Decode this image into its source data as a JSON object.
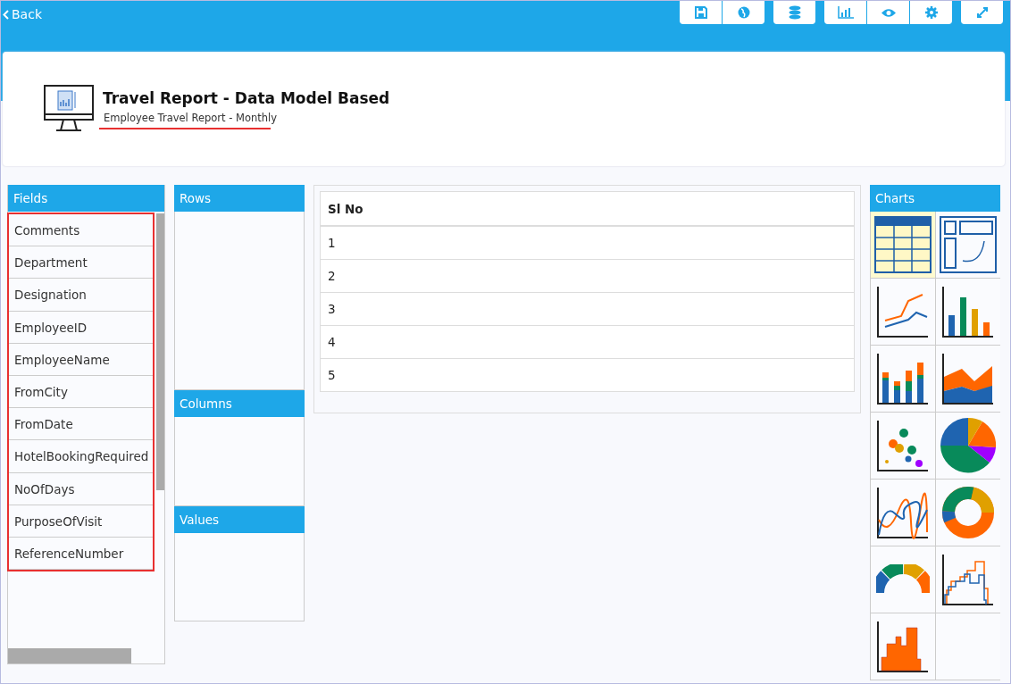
{
  "topbar": {
    "back_label": "Back"
  },
  "header": {
    "title": "Travel Report - Data Model Based",
    "subtitle": "Employee Travel Report - Monthly"
  },
  "fields": {
    "title": "Fields",
    "items": [
      "Comments",
      "Department",
      "Designation",
      "EmployeeID",
      "EmployeeName",
      "FromCity",
      "FromDate",
      "HotelBookingRequired",
      "NoOfDays",
      "PurposeOfVisit",
      "ReferenceNumber"
    ]
  },
  "drop_zones": [
    {
      "title": "Rows"
    },
    {
      "title": "Columns"
    },
    {
      "title": "Values"
    }
  ],
  "table": {
    "columns": [
      "Sl No"
    ],
    "rows": [
      [
        "1"
      ],
      [
        "2"
      ],
      [
        "3"
      ],
      [
        "4"
      ],
      [
        "5"
      ]
    ]
  },
  "charts": {
    "title": "Charts",
    "items": [
      {
        "kind": "table",
        "selected": true
      },
      {
        "kind": "pivot",
        "selected": false
      },
      {
        "kind": "line",
        "selected": false
      },
      {
        "kind": "bar",
        "selected": false
      },
      {
        "kind": "stacked",
        "selected": false
      },
      {
        "kind": "area",
        "selected": false
      },
      {
        "kind": "bubble",
        "selected": false
      },
      {
        "kind": "pie",
        "selected": false
      },
      {
        "kind": "spline",
        "selected": false
      },
      {
        "kind": "donut",
        "selected": false
      },
      {
        "kind": "gauge",
        "selected": false
      },
      {
        "kind": "step",
        "selected": false
      },
      {
        "kind": "histogram",
        "selected": false
      }
    ]
  }
}
